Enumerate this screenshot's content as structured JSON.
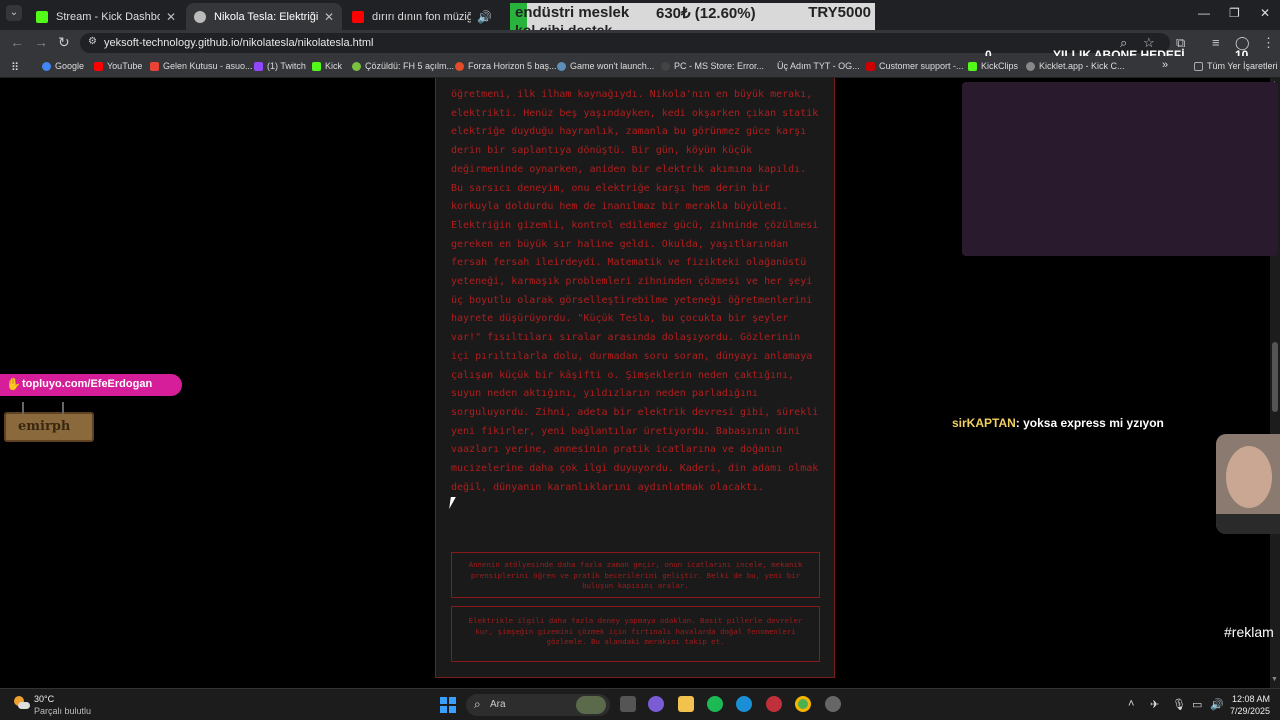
{
  "tabs": [
    {
      "label": "Stream - Kick Dashboard",
      "favicon_color": "#53fc18"
    },
    {
      "label": "Nikola Tesla: Elektriğin Dâhisi",
      "favicon_color": "#bbbbbb"
    },
    {
      "label": "dırırı dının fon müziği - YouT",
      "favicon_color": "#ff0000"
    }
  ],
  "address": {
    "url": "yeksoft-technology.github.io/nikolatesla/nikolatesla.html"
  },
  "bookmarks": [
    {
      "label": "Google",
      "color": "#4285f4"
    },
    {
      "label": "YouTube",
      "color": "#ff0000"
    },
    {
      "label": "Gelen Kutusu - asuo...",
      "color": "#ea4335"
    },
    {
      "label": "(1) Twitch",
      "color": "#9146ff"
    },
    {
      "label": "Kick",
      "color": "#53fc18"
    },
    {
      "label": "Çözüldü: FH 5 açılm...",
      "color": "#7ac142"
    },
    {
      "label": "Forza Horizon 5 baş...",
      "color": "#e34c26"
    },
    {
      "label": "Game won't launch...",
      "color": "#1b2838"
    },
    {
      "label": "PC - MS Store: Error...",
      "color": "#222222"
    },
    {
      "label": "Üç Adım TYT - OG...",
      "color": "#cc3333"
    },
    {
      "label": "Customer support -...",
      "color": "#cc0000"
    },
    {
      "label": "KickClips",
      "color": "#53fc18"
    },
    {
      "label": "Kicklet.app - Kick C...",
      "color": "#888888"
    },
    {
      "label": "»",
      "color": ""
    },
    {
      "label": "Tüm Yer İşaretleri",
      "color": "#aaaaaa"
    }
  ],
  "goal_overlay": {
    "title": "endüstri meslek",
    "amount": "630₺ (12.60%)",
    "target": "TRY5000",
    "subtitle": "kol gibi destek",
    "progress": 0.126,
    "fill_color": "#28b43c"
  },
  "sub_goal": {
    "current": "0",
    "label": "YILLIK ABONE HEDEFİ",
    "target": "10"
  },
  "article": {
    "text": "öğretmeni, ilk ilham kaynağıydı. Nikola'nın en büyük merakı, elektrikti. Henüz beş yaşındayken, kedi okşarken çıkan statik elektriğe duyduğu hayranlık, zamanla bu görünmez güce karşı derin bir saplantıya dönüştü. Bir gün, köyün küçük değirmeninde oynarken, aniden bir elektrik akımına kapıldı. Bu sarsıcı deneyim, onu elektriğe karşı hem derin bir korkuyla doldurdu hem de inanılmaz bir merakla büyüledi. Elektriğin gizemli, kontrol edilemez gücü, zihninde çözülmesi gereken en büyük sır haline geldi. Okulda, yaşıtlarından fersah fersah ileirdeydi. Matematik ve fizikteki olağanüstü yeteneği, karmaşık problemleri zihninden çözmesi ve her şeyi üç boyutlu olarak görselleştirebilme yeteneği öğretmenlerini hayrete düşürüyordu. \"Küçük Tesla, bu çocukta bir şeyler var!\" fısıltıları sıralar arasında dolaşıyordu. Gözlerinin içi pırıltılarla dolu, durmadan soru soran, dünyayı anlamaya çalışan küçük bir kâşifti o. Şimşeklerin neden çaktığını, suyun neden aktığını, yıldızların neden parladığını sorguluyordu. Zihni, adeta bir elektrik devresi gibi, sürekli yeni fikirler, yeni bağlantılar üretiyordu. Babasının dini vaazları yerine, annesinin pratik icatlarına ve doğanın mucizelerine daha çok ilgi duyuyordu. Kaderi, din adamı olmak değil, dünyanın karanlıklarını aydınlatmak olacaktı.",
    "choice_1": "Annenin atölyesinde daha fazla zaman geçir, onun icatlarını incele, mekanik prensiplerini öğren ve pratik becerilerini geliştir. Belki de bu, yeni bir buluşun kapısını aralar.",
    "choice_2": "Elektrikle ilgili daha fazla deney yapmaya odaklan. Basit pillerle devreler kur, şimşeğin gizemini çözmek için fırtınalı havalarda doğal fenomenleri gözlemle. Bu alandaki merakını takip et."
  },
  "stream": {
    "link": "topluyo.com/EfeErdogan",
    "sign": "emirph",
    "chat_user": "sirKAPTAN",
    "chat_message": ": yoksa express mi yzıyon",
    "hashtag": "#reklam"
  },
  "taskbar": {
    "temp": "30°C",
    "weather": "Parçalı bulutlu",
    "search_placeholder": "Ara",
    "time": "12:08 AM",
    "date": "7/29/2025"
  }
}
